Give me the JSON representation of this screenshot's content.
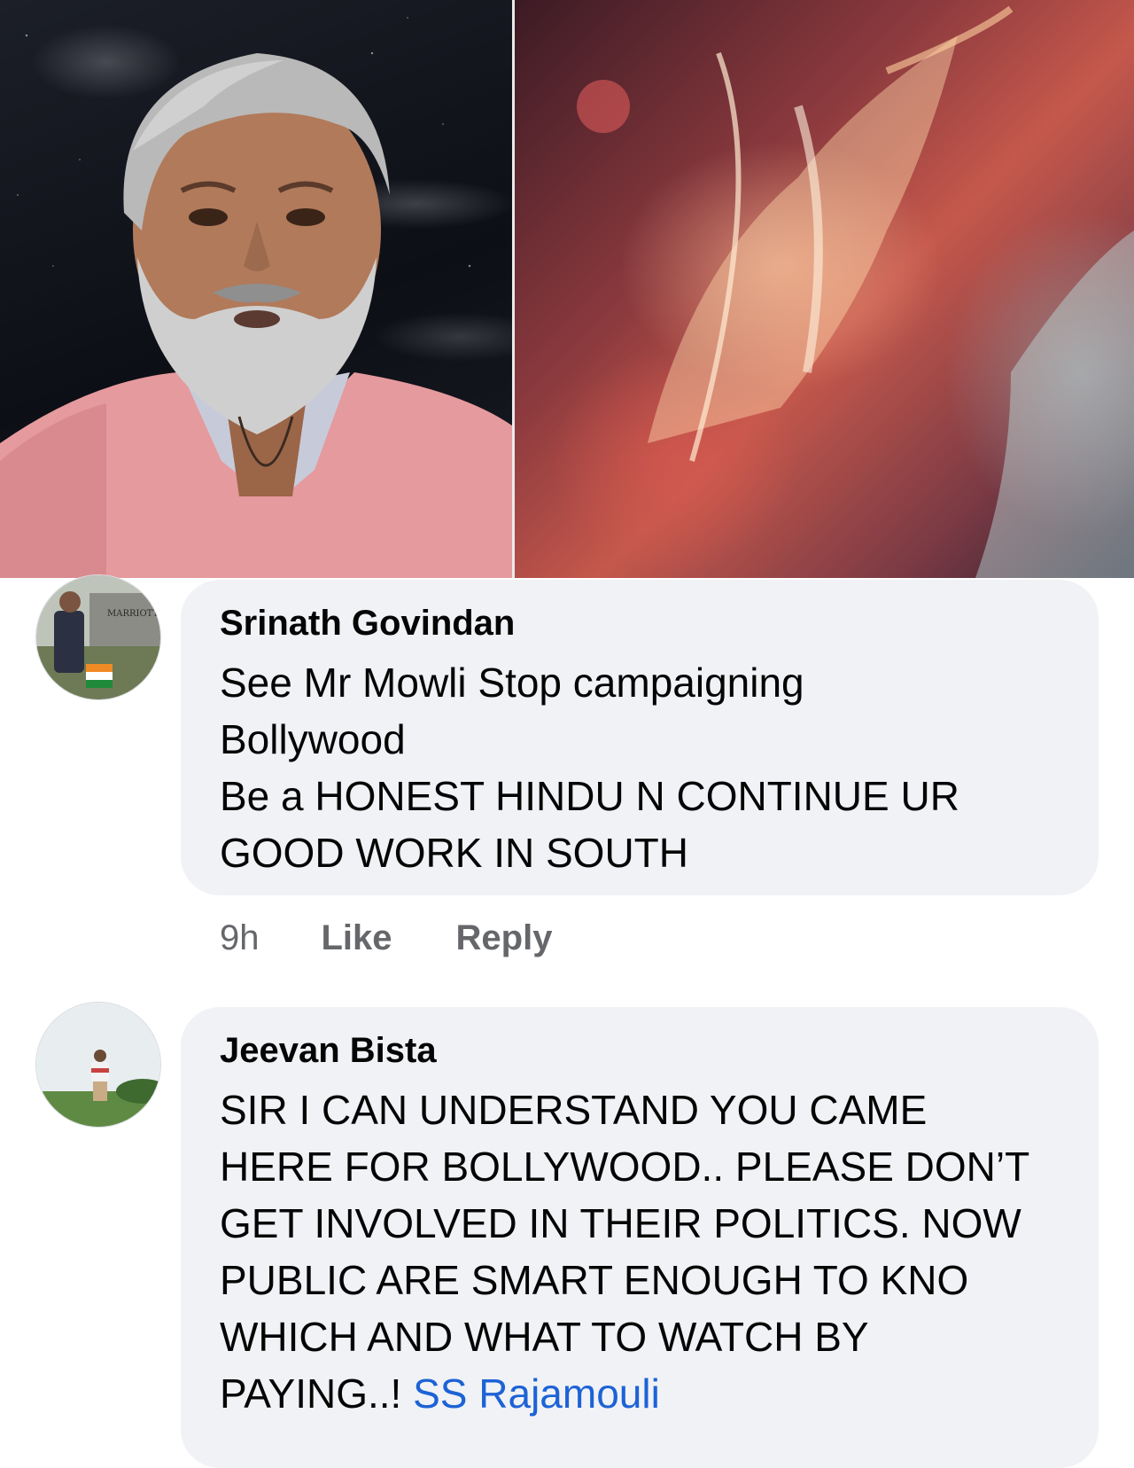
{
  "comments": [
    {
      "author": "Srinath Govindan",
      "text": "See Mr Mowli Stop campaigning\nBollywood\nBe a HONEST HINDU N CONTINUE UR\nGOOD WORK IN SOUTH",
      "time": "9h",
      "like_label": "Like",
      "reply_label": "Reply",
      "avatar_sign_text": "MARRIOTT"
    },
    {
      "author": "Jeevan Bista",
      "text": "SIR I CAN UNDERSTAND YOU CAME\nHERE FOR BOLLYWOOD.. PLEASE DON’T\nGET INVOLVED IN THEIR POLITICS. NOW\nPUBLIC ARE SMART ENOUGH TO KNO\nWHICH AND WHAT TO WATCH BY\nPAYING..! ",
      "mention": "SS Rajamouli"
    }
  ],
  "colors": {
    "bubble": "#f0f2f5",
    "mention": "#1d62d6",
    "meta": "#65676b"
  }
}
